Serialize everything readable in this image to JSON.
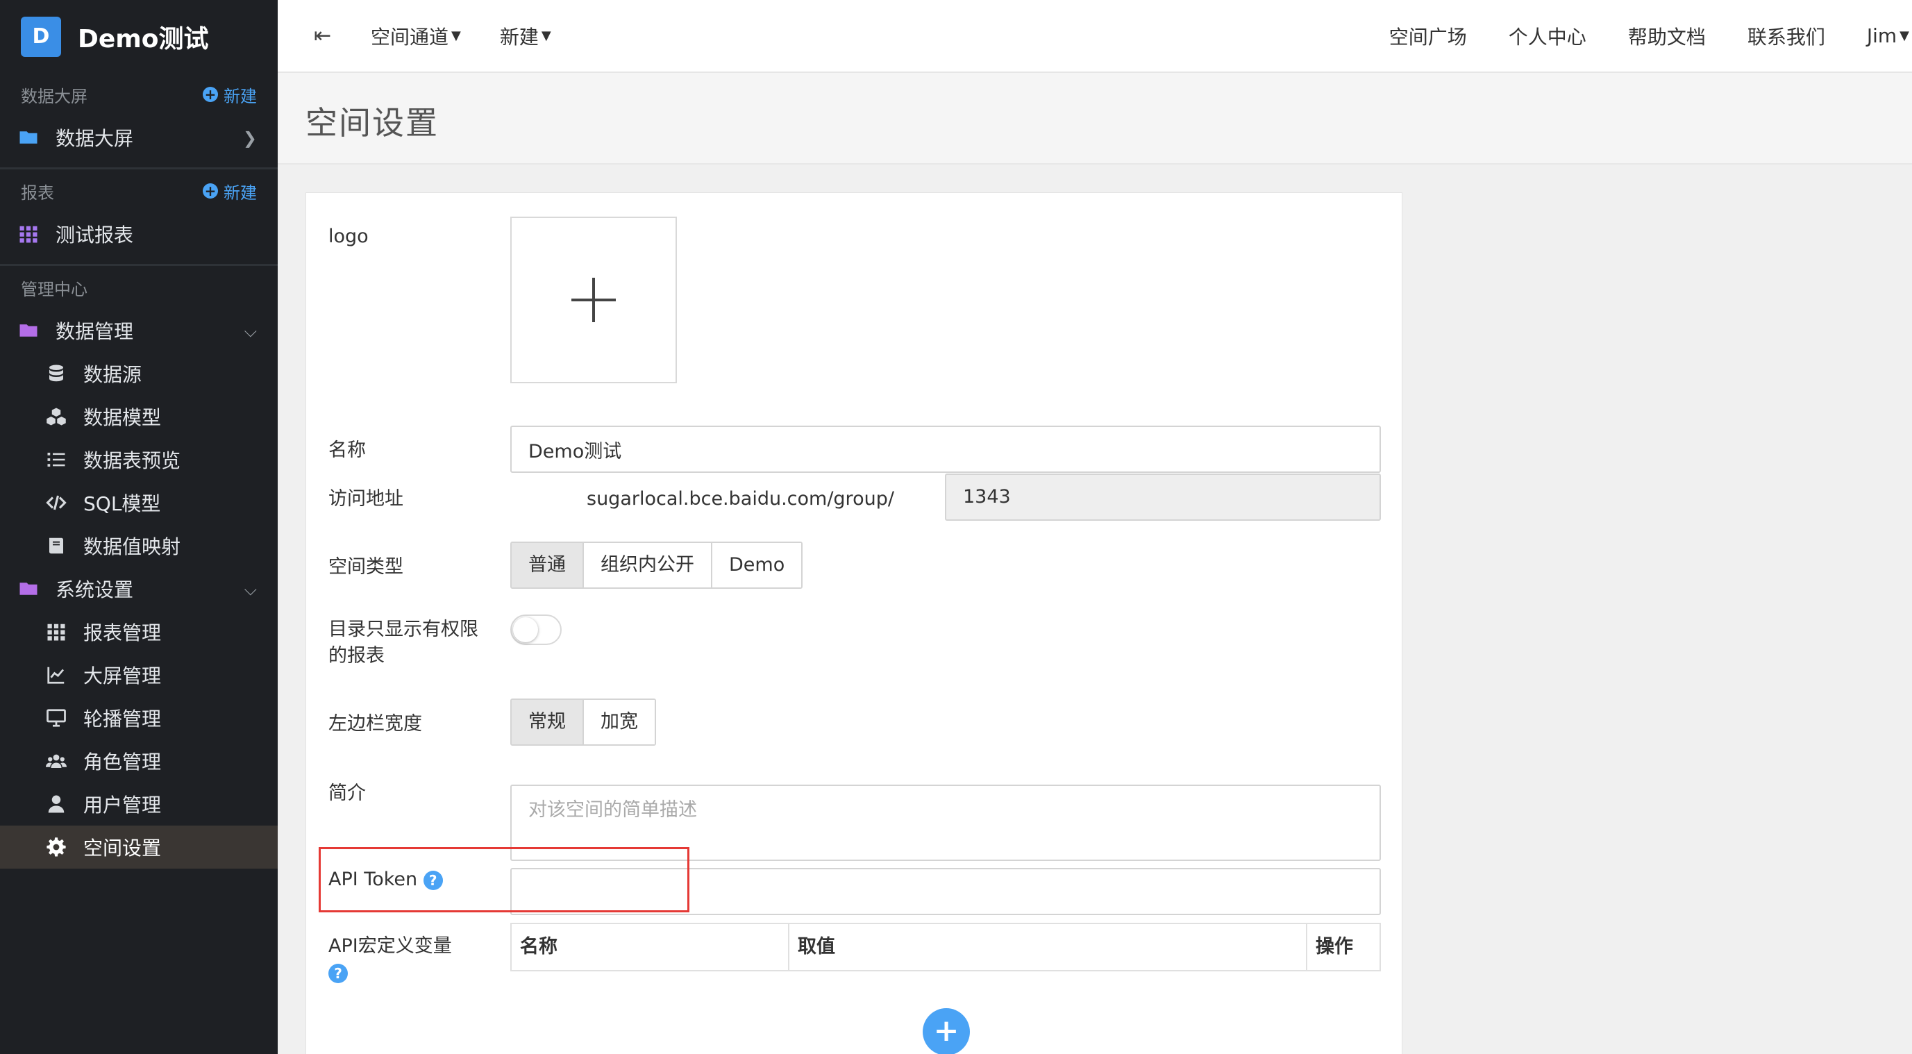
{
  "brand": {
    "initial": "D",
    "title": "Demo测试"
  },
  "sidebar": {
    "sections": [
      {
        "header": "数据大屏",
        "new_label": "新建"
      },
      {
        "header": "报表",
        "new_label": "新建"
      },
      {
        "header": "管理中心"
      }
    ],
    "items": [
      {
        "label": "数据大屏",
        "icon": "folder-icon"
      },
      {
        "label": "测试报表",
        "icon": "grid-icon"
      },
      {
        "label": "数据管理",
        "icon": "folder-icon"
      },
      {
        "label": "数据源",
        "icon": "database-icon"
      },
      {
        "label": "数据模型",
        "icon": "cubes-icon"
      },
      {
        "label": "数据表预览",
        "icon": "list-icon"
      },
      {
        "label": "SQL模型",
        "icon": "code-icon"
      },
      {
        "label": "数据值映射",
        "icon": "book-icon"
      },
      {
        "label": "系统设置",
        "icon": "folder-icon"
      },
      {
        "label": "报表管理",
        "icon": "grid-icon"
      },
      {
        "label": "大屏管理",
        "icon": "chart-icon"
      },
      {
        "label": "轮播管理",
        "icon": "monitor-icon"
      },
      {
        "label": "角色管理",
        "icon": "users-icon"
      },
      {
        "label": "用户管理",
        "icon": "user-icon"
      },
      {
        "label": "空间设置",
        "icon": "gear-icon"
      }
    ]
  },
  "topbar": {
    "space_channel": "空间通道",
    "new_menu": "新建",
    "links": [
      "空间广场",
      "个人中心",
      "帮助文档",
      "联系我们"
    ],
    "user": "Jim"
  },
  "page": {
    "title": "空间设置"
  },
  "form": {
    "logo_label": "logo",
    "name_label": "名称",
    "name_value": "Demo测试",
    "address_label": "访问地址",
    "address_prefix": "sugarlocal.bce.baidu.com/group/",
    "address_value": "1343",
    "space_type_label": "空间类型",
    "space_type_options": [
      "普通",
      "组织内公开",
      "Demo"
    ],
    "dir_perm_label": "目录只显示有权限的报表",
    "sidebar_width_label": "左边栏宽度",
    "sidebar_width_options": [
      "常规",
      "加宽"
    ],
    "intro_label": "简介",
    "intro_placeholder": "对该空间的简单描述",
    "api_token_label": "API Token",
    "api_token_value": "",
    "api_macro_label": "API宏定义变量",
    "table_headers": [
      "名称",
      "取值",
      "操作"
    ]
  },
  "colors": {
    "accent": "#4aa3f5",
    "sidebar_bg": "#1e2024",
    "highlight": "#e53935"
  }
}
